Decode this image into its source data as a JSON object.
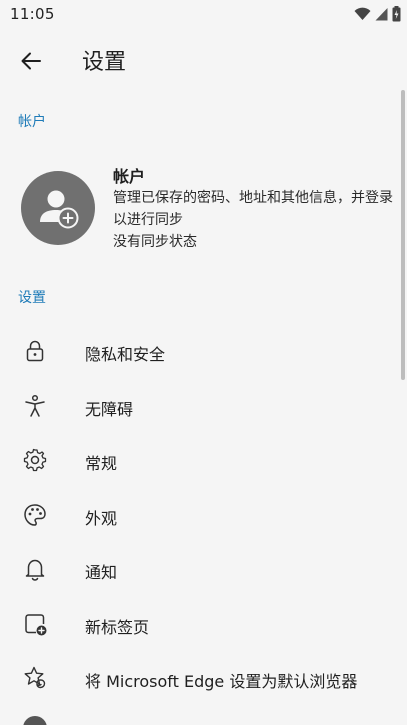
{
  "status_bar": {
    "time": "11:05"
  },
  "app_bar": {
    "title": "设置"
  },
  "sections": {
    "account_header": "帐户",
    "settings_header": "设置"
  },
  "account": {
    "title": "帐户",
    "description": "管理已保存的密码、地址和其他信息，并登录以进行同步",
    "sync_status": "没有同步状态"
  },
  "menu": {
    "items": [
      {
        "label": "隐私和安全",
        "icon": "lock-icon"
      },
      {
        "label": "无障碍",
        "icon": "accessibility-icon"
      },
      {
        "label": "常规",
        "icon": "gear-icon"
      },
      {
        "label": "外观",
        "icon": "palette-icon"
      },
      {
        "label": "通知",
        "icon": "bell-icon"
      },
      {
        "label": "新标签页",
        "icon": "new-tab-icon"
      },
      {
        "label": "将 Microsoft Edge 设置为默认浏览器",
        "icon": "default-browser-icon"
      }
    ]
  },
  "colors": {
    "accent": "#1e7bb8",
    "background": "#f5f5f5",
    "avatar": "#707070"
  }
}
